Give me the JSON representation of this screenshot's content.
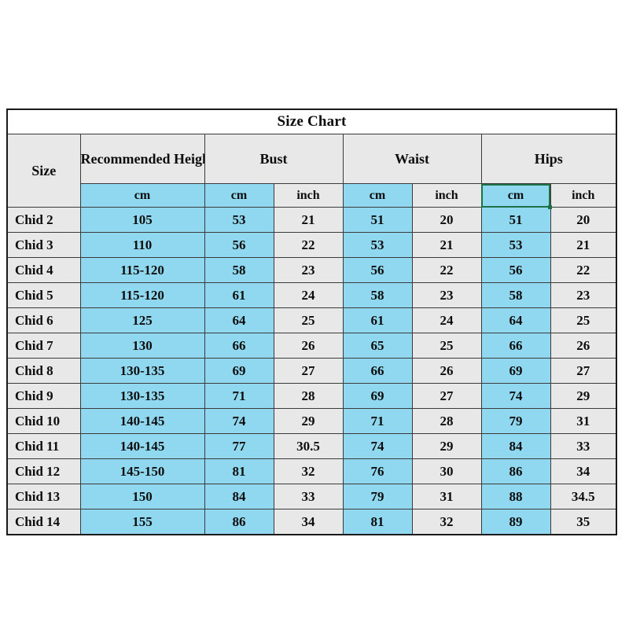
{
  "title": "Size Chart",
  "headers": {
    "size": "Size",
    "recommended_height": "Recommended Height",
    "bust": "Bust",
    "waist": "Waist",
    "hips": "Hips"
  },
  "units": {
    "height_cm": "cm",
    "bust_cm": "cm",
    "bust_inch": "inch",
    "waist_cm": "cm",
    "waist_inch": "inch",
    "hips_cm": "cm",
    "hips_inch": "inch"
  },
  "colors": {
    "cm_fill": "#8fd8f0",
    "inch_fill": "#e8e8e8",
    "header_fill": "#e8e8e8",
    "border": "#3a3a3a",
    "outer_border": "#1a1a1a",
    "selection": "#1e7145"
  },
  "selection": {
    "cell": "hips-cm-unit-header",
    "has_fill_handle": true
  },
  "chart_data": {
    "type": "table",
    "title": "Size Chart",
    "columns": [
      "Size",
      "Recommended Height (cm)",
      "Bust (cm)",
      "Bust (inch)",
      "Waist (cm)",
      "Waist (inch)",
      "Hips (cm)",
      "Hips (inch)"
    ],
    "rows": [
      [
        "Chid 2",
        "105",
        "53",
        "21",
        "51",
        "20",
        "51",
        "20"
      ],
      [
        "Chid 3",
        "110",
        "56",
        "22",
        "53",
        "21",
        "53",
        "21"
      ],
      [
        "Chid 4",
        "115-120",
        "58",
        "23",
        "56",
        "22",
        "56",
        "22"
      ],
      [
        "Chid 5",
        "115-120",
        "61",
        "24",
        "58",
        "23",
        "58",
        "23"
      ],
      [
        "Chid 6",
        "125",
        "64",
        "25",
        "61",
        "24",
        "64",
        "25"
      ],
      [
        "Chid 7",
        "130",
        "66",
        "26",
        "65",
        "25",
        "66",
        "26"
      ],
      [
        "Chid 8",
        "130-135",
        "69",
        "27",
        "66",
        "26",
        "69",
        "27"
      ],
      [
        "Chid 9",
        "130-135",
        "71",
        "28",
        "69",
        "27",
        "74",
        "29"
      ],
      [
        "Chid 10",
        "140-145",
        "74",
        "29",
        "71",
        "28",
        "79",
        "31"
      ],
      [
        "Chid 11",
        "140-145",
        "77",
        "30.5",
        "74",
        "29",
        "84",
        "33"
      ],
      [
        "Chid 12",
        "145-150",
        "81",
        "32",
        "76",
        "30",
        "86",
        "34"
      ],
      [
        "Chid 13",
        "150",
        "84",
        "33",
        "79",
        "31",
        "88",
        "34.5"
      ],
      [
        "Chid 14",
        "155",
        "86",
        "34",
        "81",
        "32",
        "89",
        "35"
      ]
    ]
  }
}
